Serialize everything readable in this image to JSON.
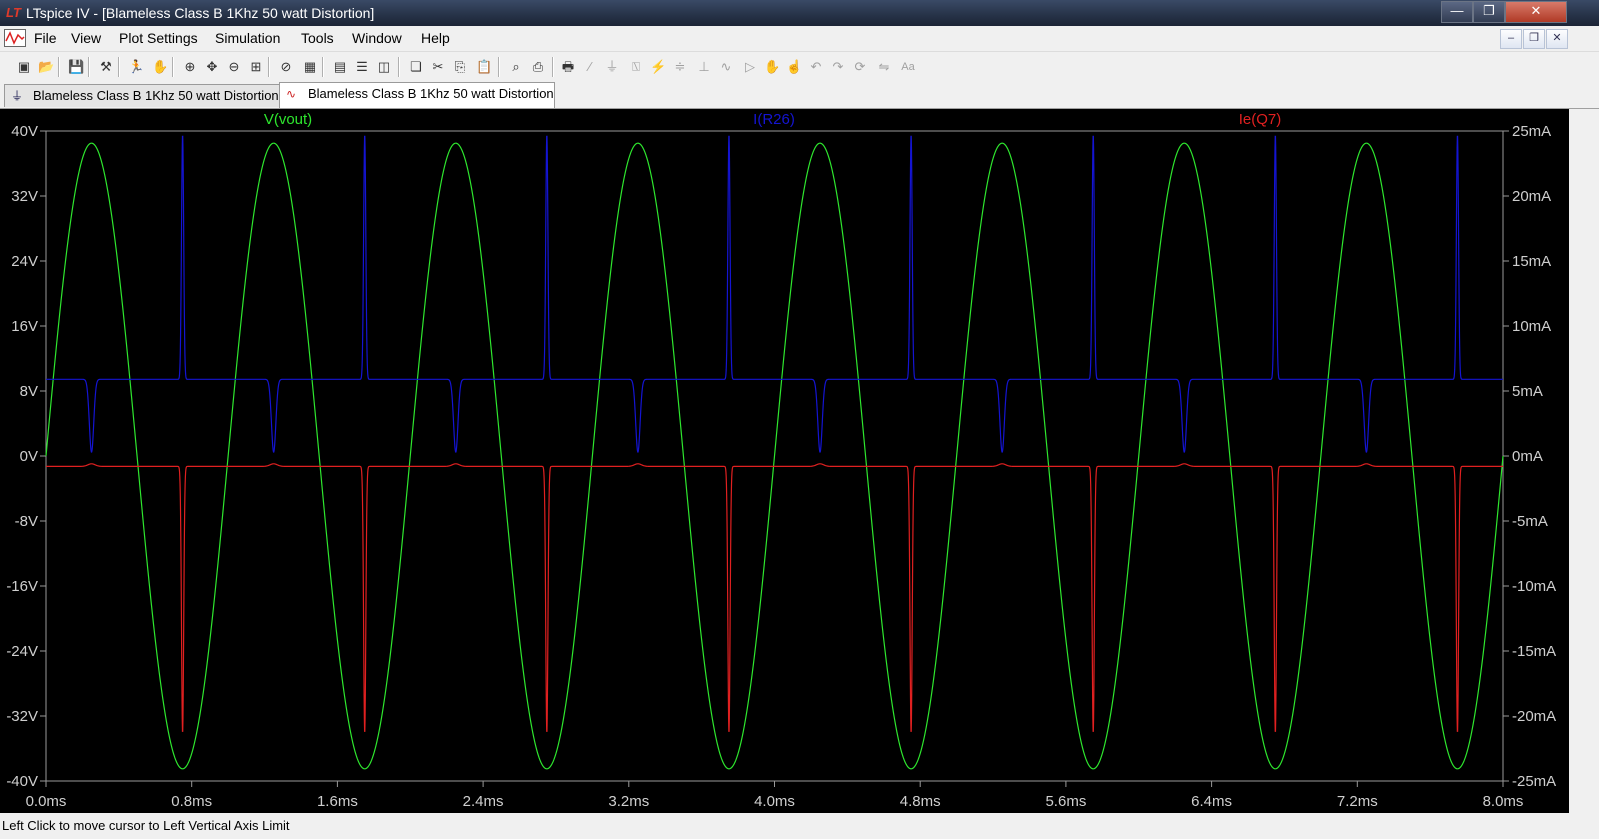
{
  "window": {
    "title": "LTspice IV - [Blameless Class B 1Khz 50 watt Distortion]",
    "logo_text": "LT",
    "controls": {
      "minimize": "—",
      "maximize": "❐",
      "close": "✕"
    }
  },
  "menu": {
    "items": [
      "File",
      "View",
      "Plot Settings",
      "Simulation",
      "Tools",
      "Window",
      "Help"
    ],
    "mdi_controls": {
      "minimize": "–",
      "restore": "❐",
      "close": "✕"
    }
  },
  "toolbar": {
    "icons": [
      "new-schematic",
      "open",
      "save",
      "hammer-control-panel",
      "run",
      "halt",
      "zoom-in",
      "pan",
      "zoom-out",
      "zoom-to-fit",
      "cancel-zoom",
      "autorange",
      "mark-data-points",
      "tile-horizontal",
      "tile-vertical",
      "cascade",
      "cut",
      "copy",
      "paste",
      "find",
      "print-preview",
      "print",
      "draw-wire",
      "ground",
      "label-net",
      "component",
      "resistor",
      "capacitor",
      "inductor",
      "diode",
      "move",
      "drag",
      "undo",
      "redo",
      "rotate",
      "mirror",
      "text",
      "spice-directive"
    ]
  },
  "tabs": [
    {
      "label": "Blameless Class B 1Khz 50 watt Distortion",
      "icon": "schematic-icon",
      "active": false
    },
    {
      "label": "Blameless Class B 1Khz 50 watt Distortion",
      "icon": "waveform-icon",
      "active": true
    }
  ],
  "chart_data": {
    "type": "line",
    "title": "",
    "xlabel": "",
    "xlim": [
      0,
      8.0
    ],
    "x_ticks": [
      "0.0ms",
      "0.8ms",
      "1.6ms",
      "2.4ms",
      "3.2ms",
      "4.0ms",
      "4.8ms",
      "5.6ms",
      "6.4ms",
      "7.2ms",
      "8.0ms"
    ],
    "y_left": {
      "range": [
        -40,
        40
      ],
      "ticks": [
        "40V",
        "32V",
        "24V",
        "16V",
        "8V",
        "0V",
        "-8V",
        "-16V",
        "-24V",
        "-32V",
        "-40V"
      ]
    },
    "y_right": {
      "range": [
        -25,
        25
      ],
      "ticks": [
        "25mA",
        "20mA",
        "15mA",
        "10mA",
        "5mA",
        "0mA",
        "-5mA",
        "-10mA",
        "-15mA",
        "-20mA",
        "-25mA"
      ]
    },
    "grid": false,
    "frequency_khz": 1,
    "series": [
      {
        "name": "V(vout)",
        "color": "#2ee62e",
        "axis": "left",
        "shape": "sine",
        "amplitude": 38.5,
        "offset": 0
      },
      {
        "name": "I(R26)",
        "color": "#1414d2",
        "axis": "right",
        "shape": "spiky",
        "baseline": 5.9,
        "positive_spike_peak": 24.7,
        "negative_dip_min": 0.3
      },
      {
        "name": "Ie(Q7)",
        "color": "#e02020",
        "axis": "right",
        "shape": "spiky",
        "baseline": -0.8,
        "positive_bump_peak": -0.6,
        "negative_spike_min": -21.3
      }
    ]
  },
  "status": {
    "text": "Left Click to move cursor to Left Vertical Axis Limit"
  }
}
